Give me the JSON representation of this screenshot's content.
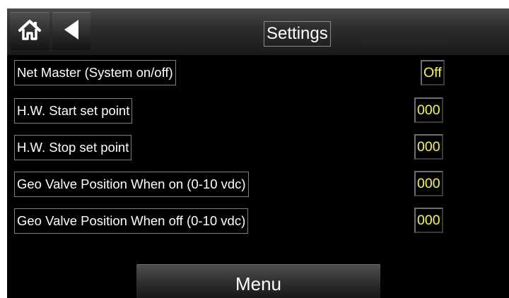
{
  "header": {
    "title": "Settings",
    "home_icon": "home-icon",
    "back_icon": "back-arrow-icon"
  },
  "rows": [
    {
      "label": "Net Master (System on/off)",
      "value": "Off"
    },
    {
      "label": "H.W. Start set point",
      "value": "000"
    },
    {
      "label": "H.W. Stop set point",
      "value": "000"
    },
    {
      "label": "Geo Valve Position When on (0-10 vdc)",
      "value": "000"
    },
    {
      "label": "Geo Valve Position When off (0-10 vdc)",
      "value": "000"
    }
  ],
  "footer": {
    "menu_label": "Menu"
  },
  "colors": {
    "background": "#000000",
    "label_text": "#ffffff",
    "value_text": "#ffff00",
    "header": "#2e2e2e"
  }
}
